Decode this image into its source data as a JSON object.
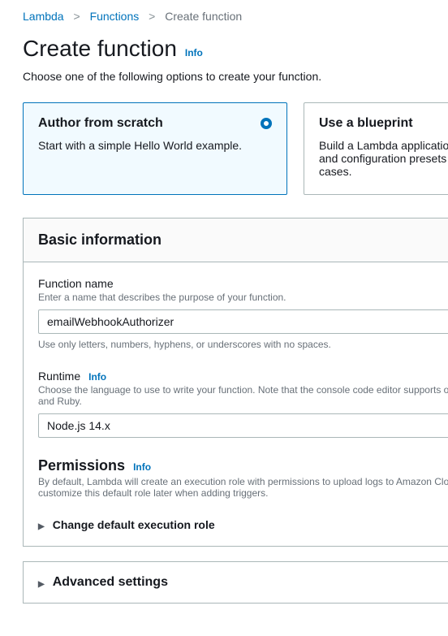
{
  "breadcrumb": {
    "lambda": "Lambda",
    "functions": "Functions",
    "current": "Create function"
  },
  "page": {
    "title": "Create function",
    "info": "Info",
    "subtitle": "Choose one of the following options to create your function."
  },
  "options": {
    "scratch": {
      "title": "Author from scratch",
      "desc": "Start with a simple Hello World example."
    },
    "blueprint": {
      "title": "Use a blueprint",
      "desc": "Build a Lambda application from sample code and configuration presets for common use cases."
    }
  },
  "basic": {
    "heading": "Basic information",
    "functionName": {
      "label": "Function name",
      "hint": "Enter a name that describes the purpose of your function.",
      "value": "emailWebhookAuthorizer",
      "constraint": "Use only letters, numbers, hyphens, or underscores with no spaces."
    },
    "runtime": {
      "label": "Runtime",
      "info": "Info",
      "hint": "Choose the language to use to write your function. Note that the console code editor supports only Node.js, Python, and Ruby.",
      "value": "Node.js 14.x"
    },
    "permissions": {
      "label": "Permissions",
      "info": "Info",
      "hint": "By default, Lambda will create an execution role with permissions to upload logs to Amazon CloudWatch Logs. You can customize this default role later when adding triggers.",
      "expander": "Change default execution role"
    }
  },
  "advanced": {
    "heading": "Advanced settings"
  }
}
